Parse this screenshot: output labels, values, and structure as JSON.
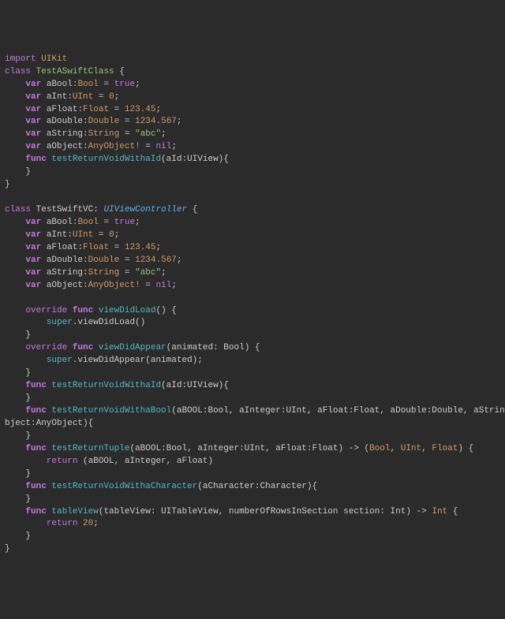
{
  "import": {
    "keyword": "import",
    "module": "UIKit"
  },
  "class1": {
    "kw": "class",
    "name": "TestASwiftClass",
    "brace": "{",
    "fields": [
      {
        "kw": "var",
        "name": "aBool",
        "type": "Bool",
        "val": "true",
        "valKind": "kw"
      },
      {
        "kw": "var",
        "name": "aInt",
        "type": "UInt",
        "val": "0",
        "valKind": "num"
      },
      {
        "kw": "var",
        "name": "aFloat",
        "type": "Float",
        "val": "123.45",
        "valKind": "num"
      },
      {
        "kw": "var",
        "name": "aDouble",
        "type": "Double",
        "val": "1234.567",
        "valKind": "num"
      },
      {
        "kw": "var",
        "name": "aString",
        "type": "String",
        "val": "\"abc\"",
        "valKind": "str"
      },
      {
        "kw": "var",
        "name": "aObject",
        "type": "AnyObject!",
        "val": "nil",
        "valKind": "kw"
      }
    ],
    "method": {
      "kw": "func",
      "name": "testReturnVoidWithaId",
      "params": "aId:UIView",
      "brace": "{"
    },
    "close": "}"
  },
  "class2": {
    "kw": "class",
    "name": "TestSwiftVC",
    "super": "UIViewController",
    "brace": "{",
    "fields": [
      {
        "kw": "var",
        "name": "aBool",
        "type": "Bool",
        "val": "true",
        "valKind": "kw"
      },
      {
        "kw": "var",
        "name": "aInt",
        "type": "UInt",
        "val": "0",
        "valKind": "num"
      },
      {
        "kw": "var",
        "name": "aFloat",
        "type": "Float",
        "val": "123.45",
        "valKind": "num"
      },
      {
        "kw": "var",
        "name": "aDouble",
        "type": "Double",
        "val": "1234.567",
        "valKind": "num"
      },
      {
        "kw": "var",
        "name": "aString",
        "type": "String",
        "val": "\"abc\"",
        "valKind": "str"
      },
      {
        "kw": "var",
        "name": "aObject",
        "type": "AnyObject!",
        "val": "nil",
        "valKind": "kw"
      }
    ],
    "m_vdl": {
      "over": "override",
      "kw": "func",
      "name": "viewDidLoad",
      "params": "",
      "brace": "{",
      "body_super": "super",
      "body_call": ".viewDidLoad()"
    },
    "m_vda": {
      "over": "override",
      "kw": "func",
      "name": "viewDidAppear",
      "params": "animated: Bool",
      "brace": "{",
      "body_super": "super",
      "body_call": ".viewDidAppear(animated);"
    },
    "m_id": {
      "kw": "func",
      "name": "testReturnVoidWithaId",
      "params": "aId:UIView",
      "brace": "{"
    },
    "m_bool": {
      "kw": "func",
      "name": "testReturnVoidWithaBool",
      "params": "aBOOL:Bool, aInteger:UInt, aFloat:Float, aDouble:Double, aString:String, aObject:AnyObject",
      "brace": "{",
      "wrap_prefix": "bject:AnyObject){"
    },
    "m_tuple": {
      "kw": "func",
      "name": "testReturnTuple",
      "params": "aBOOL:Bool, aInteger:UInt, aFloat:Float",
      "ret1": "Bool",
      "ret2": "UInt",
      "ret3": "Float",
      "brace": "{",
      "ret_kw": "return",
      "ret_val": " (aBOOL, aInteger, aFloat)"
    },
    "m_char": {
      "kw": "func",
      "name": "testReturnVoidWithaCharacter",
      "params": "aCharacter:Character",
      "brace": "{"
    },
    "m_tv": {
      "kw": "func",
      "name": "tableView",
      "params": "tableView: UITableView, numberOfRowsInSection section: Int",
      "ret": "Int",
      "brace": "{",
      "ret_kw": "return",
      "ret_val": "20"
    },
    "close": "}"
  }
}
